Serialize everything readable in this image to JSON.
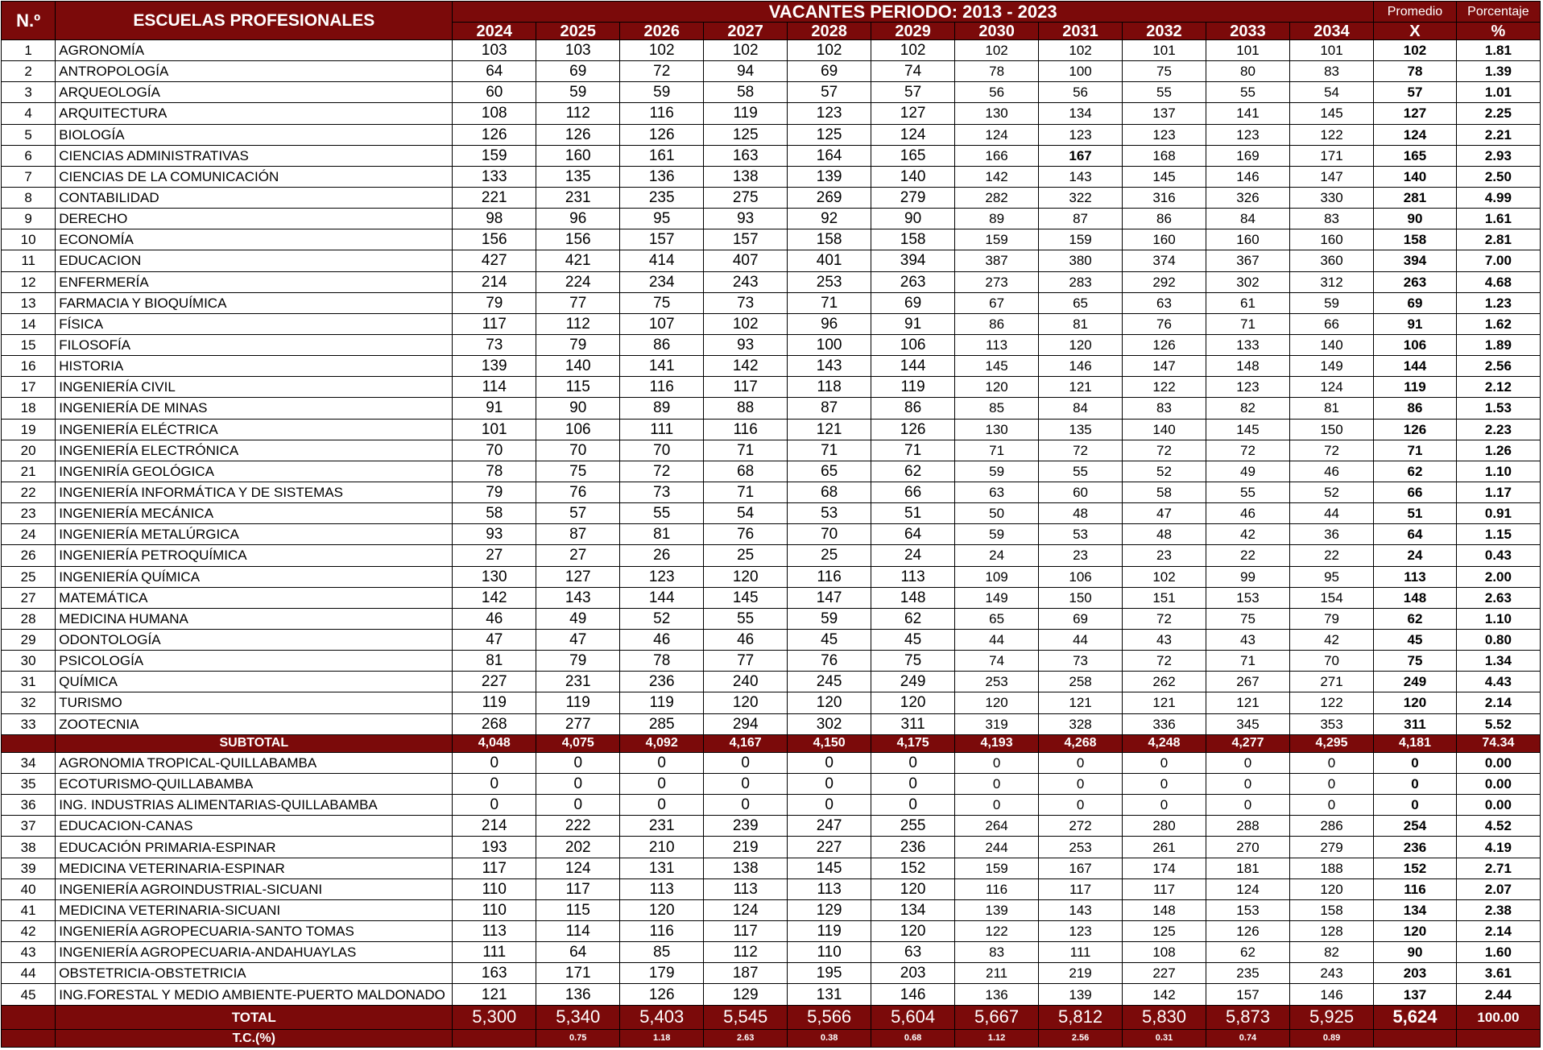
{
  "header": {
    "index_label": "N.º",
    "schools_label": "ESCUELAS PROFESIONALES",
    "period_label": "VACANTES  PERIODO:  2013 - 2023",
    "average_label": "Promedio",
    "average_symbol": "X",
    "percentage_label": "Porcentaje",
    "percentage_symbol": "%",
    "years": [
      "2024",
      "2025",
      "2026",
      "2027",
      "2028",
      "2029",
      "2030",
      "2031",
      "2032",
      "2033",
      "2034"
    ]
  },
  "rows_group1": [
    {
      "n": "1",
      "name": "AGRONOMÍA",
      "values": [
        "103",
        "103",
        "102",
        "102",
        "102",
        "102",
        "102",
        "102",
        "101",
        "101",
        "101"
      ],
      "avg": "102",
      "pct": "1.81"
    },
    {
      "n": "2",
      "name": "ANTROPOLOGÍA",
      "values": [
        "64",
        "69",
        "72",
        "94",
        "69",
        "74",
        "78",
        "100",
        "75",
        "80",
        "83"
      ],
      "avg": "78",
      "pct": "1.39"
    },
    {
      "n": "3",
      "name": "ARQUEOLOGÍA",
      "values": [
        "60",
        "59",
        "59",
        "58",
        "57",
        "57",
        "56",
        "56",
        "55",
        "55",
        "54"
      ],
      "avg": "57",
      "pct": "1.01"
    },
    {
      "n": "4",
      "name": "ARQUITECTURA",
      "values": [
        "108",
        "112",
        "116",
        "119",
        "123",
        "127",
        "130",
        "134",
        "137",
        "141",
        "145"
      ],
      "avg": "127",
      "pct": "2.25"
    },
    {
      "n": "5",
      "name": "BIOLOGÍA",
      "values": [
        "126",
        "126",
        "126",
        "125",
        "125",
        "124",
        "124",
        "123",
        "123",
        "123",
        "122"
      ],
      "avg": "124",
      "pct": "2.21"
    },
    {
      "n": "6",
      "name": "CIENCIAS ADMINISTRATIVAS",
      "values": [
        "159",
        "160",
        "161",
        "163",
        "164",
        "165",
        "166",
        "167",
        "168",
        "169",
        "171"
      ],
      "avg": "165",
      "pct": "2.93"
    },
    {
      "n": "7",
      "name": "CIENCIAS DE LA COMUNICACIÓN",
      "values": [
        "133",
        "135",
        "136",
        "138",
        "139",
        "140",
        "142",
        "143",
        "145",
        "146",
        "147"
      ],
      "avg": "140",
      "pct": "2.50"
    },
    {
      "n": "8",
      "name": "CONTABILIDAD",
      "values": [
        "221",
        "231",
        "235",
        "275",
        "269",
        "279",
        "282",
        "322",
        "316",
        "326",
        "330"
      ],
      "avg": "281",
      "pct": "4.99"
    },
    {
      "n": "9",
      "name": "DERECHO",
      "values": [
        "98",
        "96",
        "95",
        "93",
        "92",
        "90",
        "89",
        "87",
        "86",
        "84",
        "83"
      ],
      "avg": "90",
      "pct": "1.61"
    },
    {
      "n": "10",
      "name": "ECONOMÍA",
      "values": [
        "156",
        "156",
        "157",
        "157",
        "158",
        "158",
        "159",
        "159",
        "160",
        "160",
        "160"
      ],
      "avg": "158",
      "pct": "2.81"
    },
    {
      "n": "11",
      "name": "EDUCACION",
      "values": [
        "427",
        "421",
        "414",
        "407",
        "401",
        "394",
        "387",
        "380",
        "374",
        "367",
        "360"
      ],
      "avg": "394",
      "pct": "7.00"
    },
    {
      "n": "12",
      "name": "ENFERMERÍA",
      "values": [
        "214",
        "224",
        "234",
        "243",
        "253",
        "263",
        "273",
        "283",
        "292",
        "302",
        "312"
      ],
      "avg": "263",
      "pct": "4.68"
    },
    {
      "n": "13",
      "name": "FARMACIA Y BIOQUÍMICA",
      "values": [
        "79",
        "77",
        "75",
        "73",
        "71",
        "69",
        "67",
        "65",
        "63",
        "61",
        "59"
      ],
      "avg": "69",
      "pct": "1.23"
    },
    {
      "n": "14",
      "name": "FÍSICA",
      "values": [
        "117",
        "112",
        "107",
        "102",
        "96",
        "91",
        "86",
        "81",
        "76",
        "71",
        "66"
      ],
      "avg": "91",
      "pct": "1.62"
    },
    {
      "n": "15",
      "name": "FILOSOFÍA",
      "values": [
        "73",
        "79",
        "86",
        "93",
        "100",
        "106",
        "113",
        "120",
        "126",
        "133",
        "140"
      ],
      "avg": "106",
      "pct": "1.89"
    },
    {
      "n": "16",
      "name": "HISTORIA",
      "values": [
        "139",
        "140",
        "141",
        "142",
        "143",
        "144",
        "145",
        "146",
        "147",
        "148",
        "149"
      ],
      "avg": "144",
      "pct": "2.56"
    },
    {
      "n": "17",
      "name": "INGENIERÍA CIVIL",
      "values": [
        "114",
        "115",
        "116",
        "117",
        "118",
        "119",
        "120",
        "121",
        "122",
        "123",
        "124"
      ],
      "avg": "119",
      "pct": "2.12"
    },
    {
      "n": "18",
      "name": "INGENIERÍA DE MINAS",
      "values": [
        "91",
        "90",
        "89",
        "88",
        "87",
        "86",
        "85",
        "84",
        "83",
        "82",
        "81"
      ],
      "avg": "86",
      "pct": "1.53"
    },
    {
      "n": "19",
      "name": "INGENIERÍA ELÉCTRICA",
      "values": [
        "101",
        "106",
        "111",
        "116",
        "121",
        "126",
        "130",
        "135",
        "140",
        "145",
        "150"
      ],
      "avg": "126",
      "pct": "2.23"
    },
    {
      "n": "20",
      "name": "INGENIERÍA ELECTRÓNICA",
      "values": [
        "70",
        "70",
        "70",
        "71",
        "71",
        "71",
        "71",
        "72",
        "72",
        "72",
        "72"
      ],
      "avg": "71",
      "pct": "1.26"
    },
    {
      "n": "21",
      "name": "INGENIRÍA GEOLÓGICA",
      "values": [
        "78",
        "75",
        "72",
        "68",
        "65",
        "62",
        "59",
        "55",
        "52",
        "49",
        "46"
      ],
      "avg": "62",
      "pct": "1.10"
    },
    {
      "n": "22",
      "name": "INGENIERÍA INFORMÁTICA Y DE SISTEMAS",
      "values": [
        "79",
        "76",
        "73",
        "71",
        "68",
        "66",
        "63",
        "60",
        "58",
        "55",
        "52"
      ],
      "avg": "66",
      "pct": "1.17"
    },
    {
      "n": "23",
      "name": "INGENIERÍA MECÁNICA",
      "values": [
        "58",
        "57",
        "55",
        "54",
        "53",
        "51",
        "50",
        "48",
        "47",
        "46",
        "44"
      ],
      "avg": "51",
      "pct": "0.91"
    },
    {
      "n": "24",
      "name": "INGENIERÍA METALÚRGICA",
      "values": [
        "93",
        "87",
        "81",
        "76",
        "70",
        "64",
        "59",
        "53",
        "48",
        "42",
        "36"
      ],
      "avg": "64",
      "pct": "1.15"
    },
    {
      "n": "26",
      "name": "INGENIERÍA PETROQUÍMICA",
      "values": [
        "27",
        "27",
        "26",
        "25",
        "25",
        "24",
        "24",
        "23",
        "23",
        "22",
        "22"
      ],
      "avg": "24",
      "pct": "0.43"
    },
    {
      "n": "25",
      "name": "INGENIERÍA QUÍMICA",
      "values": [
        "130",
        "127",
        "123",
        "120",
        "116",
        "113",
        "109",
        "106",
        "102",
        "99",
        "95"
      ],
      "avg": "113",
      "pct": "2.00"
    },
    {
      "n": "27",
      "name": "MATEMÁTICA",
      "values": [
        "142",
        "143",
        "144",
        "145",
        "147",
        "148",
        "149",
        "150",
        "151",
        "153",
        "154"
      ],
      "avg": "148",
      "pct": "2.63"
    },
    {
      "n": "28",
      "name": "MEDICINA HUMANA",
      "values": [
        "46",
        "49",
        "52",
        "55",
        "59",
        "62",
        "65",
        "69",
        "72",
        "75",
        "79"
      ],
      "avg": "62",
      "pct": "1.10"
    },
    {
      "n": "29",
      "name": "ODONTOLOGÍA",
      "values": [
        "47",
        "47",
        "46",
        "46",
        "45",
        "45",
        "44",
        "44",
        "43",
        "43",
        "42"
      ],
      "avg": "45",
      "pct": "0.80"
    },
    {
      "n": "30",
      "name": "PSICOLOGÍA",
      "values": [
        "81",
        "79",
        "78",
        "77",
        "76",
        "75",
        "74",
        "73",
        "72",
        "71",
        "70"
      ],
      "avg": "75",
      "pct": "1.34"
    },
    {
      "n": "31",
      "name": "QUÍMICA",
      "values": [
        "227",
        "231",
        "236",
        "240",
        "245",
        "249",
        "253",
        "258",
        "262",
        "267",
        "271"
      ],
      "avg": "249",
      "pct": "4.43"
    },
    {
      "n": "32",
      "name": "TURISMO",
      "values": [
        "119",
        "119",
        "119",
        "120",
        "120",
        "120",
        "120",
        "121",
        "121",
        "121",
        "122"
      ],
      "avg": "120",
      "pct": "2.14"
    },
    {
      "n": "33",
      "name": "ZOOTECNIA",
      "values": [
        "268",
        "277",
        "285",
        "294",
        "302",
        "311",
        "319",
        "328",
        "336",
        "345",
        "353"
      ],
      "avg": "311",
      "pct": "5.52"
    }
  ],
  "subtotal": {
    "label": "SUBTOTAL",
    "values": [
      "4,048",
      "4,075",
      "4,092",
      "4,167",
      "4,150",
      "4,175",
      "4,193",
      "4,268",
      "4,248",
      "4,277",
      "4,295"
    ],
    "avg": "4,181",
    "pct": "74.34"
  },
  "rows_group2": [
    {
      "n": "34",
      "name": "AGRONOMIA TROPICAL-QUILLABAMBA",
      "values": [
        "0",
        "0",
        "0",
        "0",
        "0",
        "0",
        "0",
        "0",
        "0",
        "0",
        "0"
      ],
      "avg": "0",
      "pct": "0.00"
    },
    {
      "n": "35",
      "name": "ECOTURISMO-QUILLABAMBA",
      "values": [
        "0",
        "0",
        "0",
        "0",
        "0",
        "0",
        "0",
        "0",
        "0",
        "0",
        "0"
      ],
      "avg": "0",
      "pct": "0.00"
    },
    {
      "n": "36",
      "name": "ING. INDUSTRIAS ALIMENTARIAS-QUILLABAMBA",
      "values": [
        "0",
        "0",
        "0",
        "0",
        "0",
        "0",
        "0",
        "0",
        "0",
        "0",
        "0"
      ],
      "avg": "0",
      "pct": "0.00"
    },
    {
      "n": "37",
      "name": "EDUCACION-CANAS",
      "values": [
        "214",
        "222",
        "231",
        "239",
        "247",
        "255",
        "264",
        "272",
        "280",
        "288",
        "286"
      ],
      "avg": "254",
      "pct": "4.52"
    },
    {
      "n": "38",
      "name": "EDUCACIÓN PRIMARIA-ESPINAR",
      "values": [
        "193",
        "202",
        "210",
        "219",
        "227",
        "236",
        "244",
        "253",
        "261",
        "270",
        "279"
      ],
      "avg": "236",
      "pct": "4.19"
    },
    {
      "n": "39",
      "name": "MEDICINA VETERINARIA-ESPINAR",
      "values": [
        "117",
        "124",
        "131",
        "138",
        "145",
        "152",
        "159",
        "167",
        "174",
        "181",
        "188"
      ],
      "avg": "152",
      "pct": "2.71"
    },
    {
      "n": "40",
      "name": "INGENIERÍA AGROINDUSTRIAL-SICUANI",
      "values": [
        "110",
        "117",
        "113",
        "113",
        "113",
        "120",
        "116",
        "117",
        "117",
        "124",
        "120"
      ],
      "avg": "116",
      "pct": "2.07"
    },
    {
      "n": "41",
      "name": "MEDICINA VETERINARIA-SICUANI",
      "values": [
        "110",
        "115",
        "120",
        "124",
        "129",
        "134",
        "139",
        "143",
        "148",
        "153",
        "158"
      ],
      "avg": "134",
      "pct": "2.38"
    },
    {
      "n": "42",
      "name": "INGENIERÍA AGROPECUARIA-SANTO TOMAS",
      "values": [
        "113",
        "114",
        "116",
        "117",
        "119",
        "120",
        "122",
        "123",
        "125",
        "126",
        "128"
      ],
      "avg": "120",
      "pct": "2.14"
    },
    {
      "n": "43",
      "name": "INGENIERÍA AGROPECUARIA-ANDAHUAYLAS",
      "values": [
        "111",
        "64",
        "85",
        "112",
        "110",
        "63",
        "83",
        "111",
        "108",
        "62",
        "82"
      ],
      "avg": "90",
      "pct": "1.60"
    },
    {
      "n": "44",
      "name": "OBSTETRICIA-OBSTETRICIA",
      "values": [
        "163",
        "171",
        "179",
        "187",
        "195",
        "203",
        "211",
        "219",
        "227",
        "235",
        "243"
      ],
      "avg": "203",
      "pct": "3.61"
    },
    {
      "n": "45",
      "name": "ING.FORESTAL Y MEDIO AMBIENTE-PUERTO MALDONADO",
      "values": [
        "121",
        "136",
        "126",
        "129",
        "131",
        "146",
        "136",
        "139",
        "142",
        "157",
        "146"
      ],
      "avg": "137",
      "pct": "2.44"
    }
  ],
  "total": {
    "label": "TOTAL",
    "values": [
      "5,300",
      "5,340",
      "5,403",
      "5,545",
      "5,566",
      "5,604",
      "5,667",
      "5,812",
      "5,830",
      "5,873",
      "5,925"
    ],
    "avg": "5,624",
    "pct": "100.00"
  },
  "tc": {
    "label": "T.C.(%)",
    "values": [
      "",
      "0.75",
      "1.18",
      "2.63",
      "0.38",
      "0.68",
      "1.12",
      "2.56",
      "0.31",
      "0.74",
      "0.89"
    ]
  },
  "colors": {
    "header_bg": "#7b0a0a",
    "header_text": "#ffffff",
    "grid": "#000000"
  }
}
